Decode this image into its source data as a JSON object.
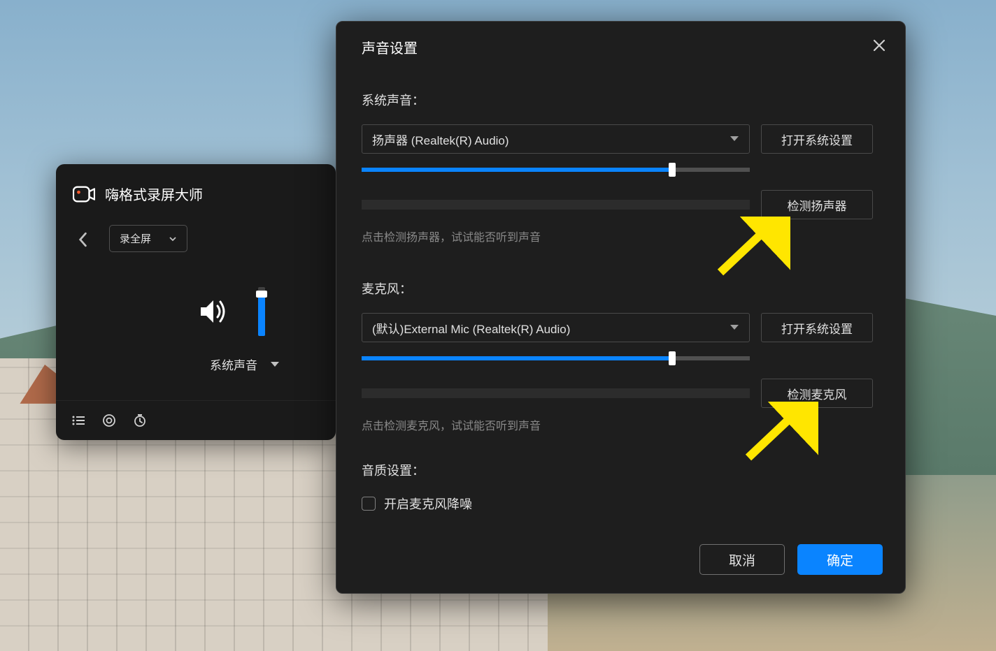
{
  "recorder": {
    "title": "嗨格式录屏大师",
    "region_select": "录全屏",
    "sys_sound_label": "系统声音"
  },
  "dialog": {
    "title": "声音设置",
    "system_sound": {
      "label": "系统声音：",
      "device": "扬声器 (Realtek(R) Audio)",
      "open_settings": "打开系统设置",
      "slider_percent": 80,
      "test_btn": "检测扬声器",
      "hint": "点击检测扬声器，试试能否听到声音"
    },
    "microphone": {
      "label": "麦克风：",
      "device": "(默认)External Mic (Realtek(R) Audio)",
      "open_settings": "打开系统设置",
      "slider_percent": 80,
      "test_btn": "检测麦克风",
      "hint": "点击检测麦克风，试试能否听到声音"
    },
    "quality": {
      "label": "音质设置：",
      "noise_reduction": "开启麦克风降噪"
    },
    "footer": {
      "cancel": "取消",
      "ok": "确定"
    }
  }
}
